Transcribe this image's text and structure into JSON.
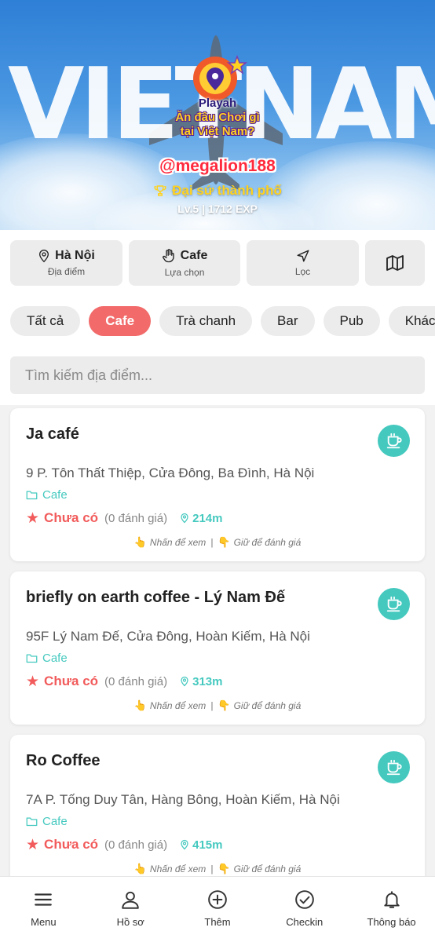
{
  "colors": {
    "accent_red": "#f26a6a",
    "teal": "#45c9bf",
    "rank_gold": "#ffd21f",
    "username_red": "#ff2a3d"
  },
  "hero": {
    "background_text": "VIETNAM",
    "logo_title": "Playah",
    "logo_line1": "Ăn đâu Chơi gì",
    "logo_line2": "tại Việt Nam?",
    "username": "@megalion188",
    "rank_icon": "trophy-icon",
    "rank": "Đại sứ thành phố",
    "level": "Lv.5 | 1712 EXP"
  },
  "filters": {
    "location": {
      "icon": "map-pin-icon",
      "value": "Hà Nội",
      "caption": "Địa điểm"
    },
    "choice": {
      "icon": "hand-icon",
      "value": "Cafe",
      "caption": "Lựa chọn"
    },
    "filter": {
      "icon": "navigation-arrow-icon",
      "caption": "Lọc"
    },
    "map": {
      "icon": "map-icon"
    }
  },
  "categories": [
    "Tất cả",
    "Cafe",
    "Trà chanh",
    "Bar",
    "Pub",
    "Khác"
  ],
  "selected_category": "Cafe",
  "search": {
    "placeholder": "Tìm kiếm địa điểm..."
  },
  "places": [
    {
      "name": "Ja café",
      "address": "9 P. Tôn Thất Thiệp, Cửa Đông, Ba Đình, Hà Nội",
      "category": "Cafe",
      "rating_label": "Chưa có",
      "review_count": "(0 đánh giá)",
      "distance": "214m",
      "hint_view": "Nhấn để xem",
      "hint_separator": "|",
      "hint_rate": "Giữ để đánh giá"
    },
    {
      "name": "briefly on earth coffee - Lý Nam Đế",
      "address": "95F Lý Nam Đế, Cửa Đông, Hoàn Kiếm, Hà Nội",
      "category": "Cafe",
      "rating_label": "Chưa có",
      "review_count": "(0 đánh giá)",
      "distance": "313m",
      "hint_view": "Nhấn để xem",
      "hint_separator": "|",
      "hint_rate": "Giữ để đánh giá"
    },
    {
      "name": "Ro Coffee",
      "address": "7A P. Tống Duy Tân, Hàng Bông, Hoàn Kiếm, Hà Nội",
      "category": "Cafe",
      "rating_label": "Chưa có",
      "review_count": "(0 đánh giá)",
      "distance": "415m",
      "hint_view": "Nhấn để xem",
      "hint_separator": "|",
      "hint_rate": "Giữ để đánh giá"
    }
  ],
  "tabbar": [
    {
      "label": "Menu",
      "icon": "hamburger-menu-icon"
    },
    {
      "label": "Hồ sơ",
      "icon": "user-icon"
    },
    {
      "label": "Thêm",
      "icon": "plus-circle-icon"
    },
    {
      "label": "Checkin",
      "icon": "check-circle-icon"
    },
    {
      "label": "Thông báo",
      "icon": "bell-icon"
    }
  ]
}
